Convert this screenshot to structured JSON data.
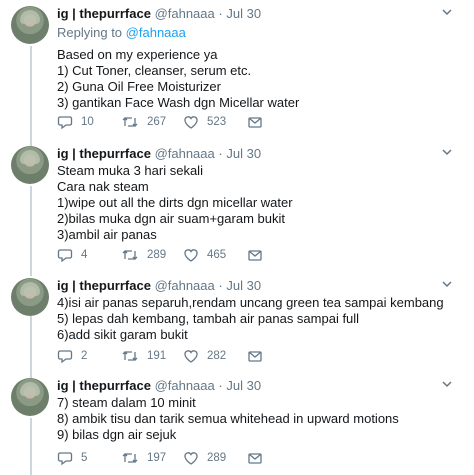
{
  "tweets": [
    {
      "name": "ig | thepurrface",
      "handle": "@fahnaaa",
      "date": "Jul 30",
      "replying_prefix": "Replying to",
      "replying_to": "@fahnaaa",
      "lines": [
        "Based on my experience ya",
        "1) Cut Toner, cleanser, serum etc.",
        "2) Guna Oil Free Moisturizer",
        "3) gantikan Face Wash dgn Micellar water"
      ],
      "replies": "10",
      "retweets": "267",
      "likes": "523"
    },
    {
      "name": "ig | thepurrface",
      "handle": "@fahnaaa",
      "date": "Jul 30",
      "lines": [
        "Steam muka 3 hari sekali",
        "Cara nak steam",
        "1)wipe out all the dirts dgn micellar water",
        "2)bilas muka dgn air suam+garam bukit",
        "3)ambil air panas"
      ],
      "replies": "4",
      "retweets": "289",
      "likes": "465"
    },
    {
      "name": "ig | thepurrface",
      "handle": "@fahnaaa",
      "date": "Jul 30",
      "lines": [
        "4)isi air panas separuh,rendam uncang green tea sampai kembang",
        "5) lepas dah kembang, tambah air panas sampai full",
        "6)add sikit garam bukit"
      ],
      "replies": "2",
      "retweets": "191",
      "likes": "282"
    },
    {
      "name": "ig | thepurrface",
      "handle": "@fahnaaa",
      "date": "Jul 30",
      "lines": [
        "7) steam dalam 10 minit",
        "8) ambik tisu dan tarik semua whitehead in upward motions",
        "9) bilas dgn air sejuk"
      ],
      "replies": "5",
      "retweets": "197",
      "likes": "289"
    }
  ],
  "separator_dot": "·",
  "icons": [
    "reply-icon",
    "retweet-icon",
    "like-icon",
    "dm-icon",
    "caret-down-icon",
    "avatar"
  ],
  "colors": {
    "link": "#1da1f2",
    "muted": "#657786",
    "text": "#14171a",
    "thread_line": "#ccd6dd"
  }
}
